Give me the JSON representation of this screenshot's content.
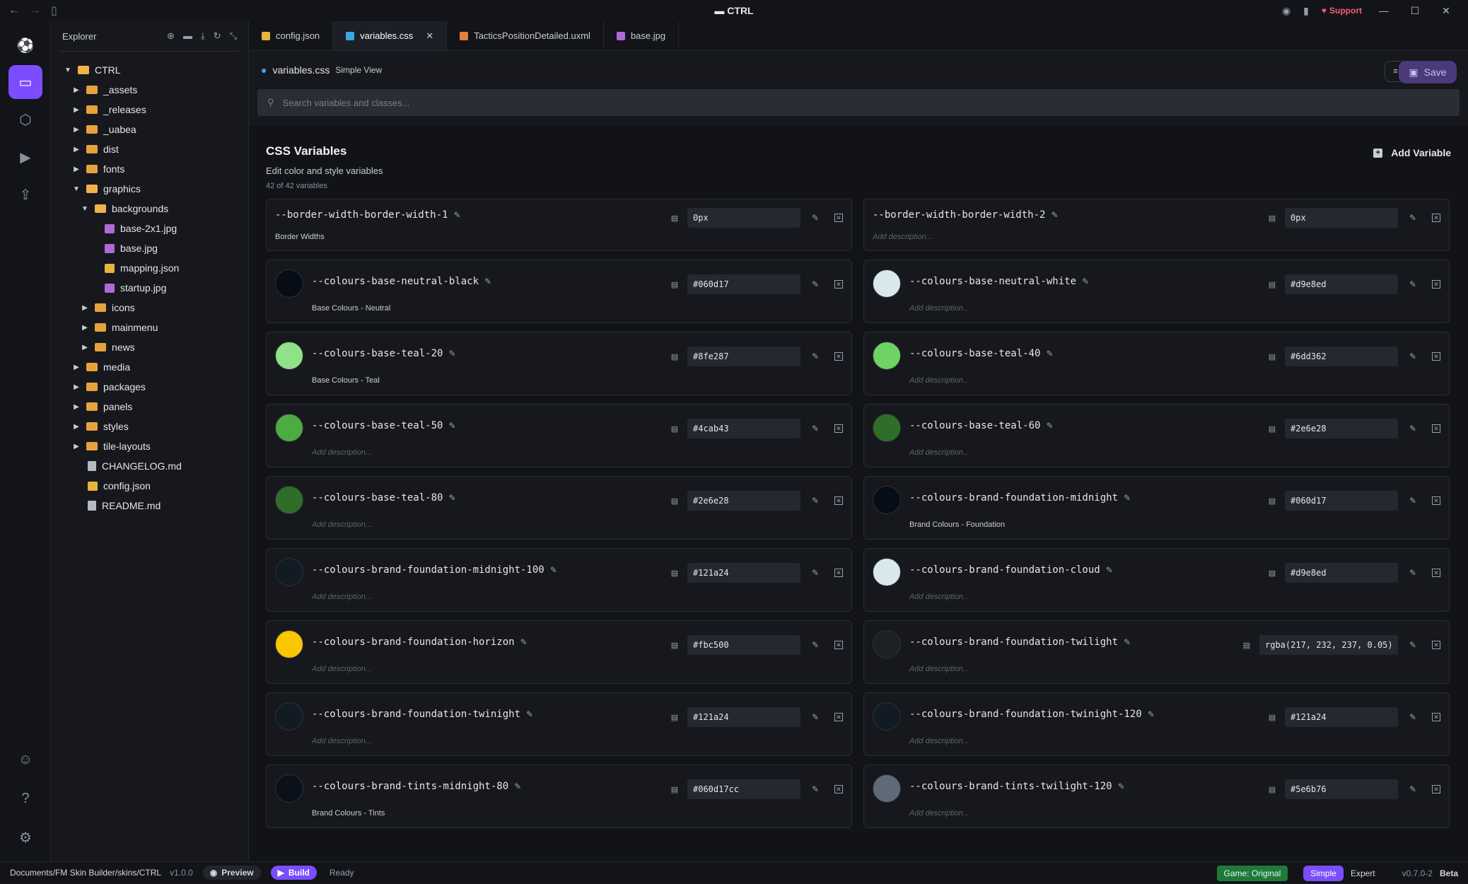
{
  "window": {
    "title": "CTRL",
    "support_label": "Support"
  },
  "explorer": {
    "title": "Explorer",
    "tree": [
      {
        "label": "CTRL",
        "type": "folder",
        "open": true,
        "depth": 0
      },
      {
        "label": "_assets",
        "type": "folder",
        "depth": 1
      },
      {
        "label": "_releases",
        "type": "folder",
        "depth": 1
      },
      {
        "label": "_uabea",
        "type": "folder",
        "depth": 1
      },
      {
        "label": "dist",
        "type": "folder",
        "depth": 1
      },
      {
        "label": "fonts",
        "type": "folder",
        "depth": 1
      },
      {
        "label": "graphics",
        "type": "folder",
        "open": true,
        "depth": 1
      },
      {
        "label": "backgrounds",
        "type": "folder",
        "open": true,
        "depth": 2
      },
      {
        "label": "base-2x1.jpg",
        "type": "image",
        "depth": 3
      },
      {
        "label": "base.jpg",
        "type": "image",
        "depth": 3
      },
      {
        "label": "mapping.json",
        "type": "json",
        "depth": 3
      },
      {
        "label": "startup.jpg",
        "type": "image",
        "depth": 3
      },
      {
        "label": "icons",
        "type": "folder",
        "depth": 2
      },
      {
        "label": "mainmenu",
        "type": "folder",
        "depth": 2
      },
      {
        "label": "news",
        "type": "folder",
        "depth": 2
      },
      {
        "label": "media",
        "type": "folder",
        "depth": 1
      },
      {
        "label": "packages",
        "type": "folder",
        "depth": 1
      },
      {
        "label": "panels",
        "type": "folder",
        "depth": 1
      },
      {
        "label": "styles",
        "type": "folder",
        "depth": 1
      },
      {
        "label": "tile-layouts",
        "type": "folder",
        "depth": 1
      },
      {
        "label": "CHANGELOG.md",
        "type": "md",
        "depth": 1
      },
      {
        "label": "config.json",
        "type": "json",
        "depth": 1
      },
      {
        "label": "README.md",
        "type": "md",
        "depth": 1
      }
    ]
  },
  "tabs": [
    {
      "label": "config.json",
      "color": "#e6b43c"
    },
    {
      "label": "variables.css",
      "color": "#3ba7e6",
      "active": true
    },
    {
      "label": "TacticsPositionDetailed.uxml",
      "color": "#e67e3c"
    },
    {
      "label": "base.jpg",
      "color": "#b06ad8"
    }
  ],
  "editor": {
    "filename": "variables.css",
    "view_label": "Simple View",
    "save_label": "Save",
    "search_placeholder": "Search variables and classes...",
    "section_title": "CSS Variables",
    "section_subtitle": "Edit color and style variables",
    "count_label": "42 of 42 variables",
    "add_label": "Add Variable",
    "desc_placeholder": "Add description..."
  },
  "variables": [
    {
      "name": "--border-width-border-width-1",
      "value": "0px",
      "desc": "Border Widths",
      "swatch": null
    },
    {
      "name": "--border-width-border-width-2",
      "value": "0px",
      "desc": "",
      "swatch": null
    },
    {
      "name": "--colours-base-neutral-black",
      "value": "#060d17",
      "desc": "Base Colours - Neutral",
      "swatch": "#060d17"
    },
    {
      "name": "--colours-base-neutral-white",
      "value": "#d9e8ed",
      "desc": "",
      "swatch": "#d9e8ed"
    },
    {
      "name": "--colours-base-teal-20",
      "value": "#8fe287",
      "desc": "Base Colours - Teal",
      "swatch": "#8fe287"
    },
    {
      "name": "--colours-base-teal-40",
      "value": "#6dd362",
      "desc": "",
      "swatch": "#6dd362"
    },
    {
      "name": "--colours-base-teal-50",
      "value": "#4cab43",
      "desc": "",
      "swatch": "#4cab43"
    },
    {
      "name": "--colours-base-teal-60",
      "value": "#2e6e28",
      "desc": "",
      "swatch": "#2e6e28"
    },
    {
      "name": "--colours-base-teal-80",
      "value": "#2e6e28",
      "desc": "",
      "swatch": "#2e6e28"
    },
    {
      "name": "--colours-brand-foundation-midnight",
      "value": "#060d17",
      "desc": "Brand Colours - Foundation",
      "swatch": "#060d17"
    },
    {
      "name": "--colours-brand-foundation-midnight-100",
      "value": "#121a24",
      "desc": "",
      "swatch": "#121a24"
    },
    {
      "name": "--colours-brand-foundation-cloud",
      "value": "#d9e8ed",
      "desc": "",
      "swatch": "#d9e8ed"
    },
    {
      "name": "--colours-brand-foundation-horizon",
      "value": "#fbc500",
      "desc": "",
      "swatch": "#fbc500"
    },
    {
      "name": "--colours-brand-foundation-twilight",
      "value": "rgba(217, 232, 237, 0.05)",
      "desc": "",
      "swatch": "#1d2025"
    },
    {
      "name": "--colours-brand-foundation-twinight",
      "value": "#121a24",
      "desc": "",
      "swatch": "#121a24"
    },
    {
      "name": "--colours-brand-foundation-twinight-120",
      "value": "#121a24",
      "desc": "",
      "swatch": "#121a24"
    },
    {
      "name": "--colours-brand-tints-midnight-80",
      "value": "#060d17cc",
      "desc": "Brand Colours - Tints",
      "swatch": "#0a111b"
    },
    {
      "name": "--colours-brand-tints-twilight-120",
      "value": "#5e6b76",
      "desc": "",
      "swatch": "#5e6b76"
    }
  ],
  "status": {
    "path": "Documents/FM Skin Builder/skins/CTRL",
    "version": "v1.0.0",
    "preview_label": "Preview",
    "build_label": "Build",
    "state": "Ready",
    "game_label": "Game: Original",
    "mode_simple": "Simple",
    "mode_expert": "Expert",
    "app_version": "v0.7.0-2",
    "channel": "Beta"
  }
}
